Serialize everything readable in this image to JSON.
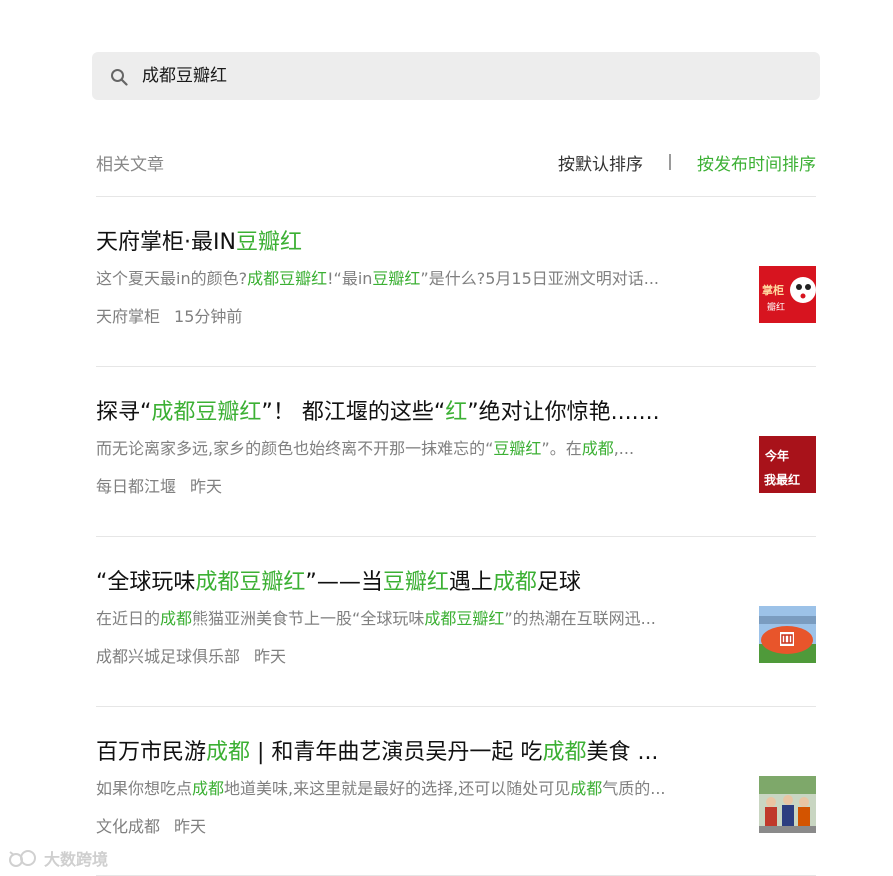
{
  "search": {
    "query": "成都豆瓣红",
    "icon": "search-icon"
  },
  "header": {
    "title": "相关文章",
    "sort_default": "按默认排序",
    "sort_time": "按发布时间排序"
  },
  "colors": {
    "highlight": "#3cb034",
    "muted": "#808080",
    "search_bg": "#ededed"
  },
  "articles": [
    {
      "title": [
        {
          "t": "天府掌柜·最IN",
          "h": false
        },
        {
          "t": "豆瓣红",
          "h": true
        }
      ],
      "snippet": [
        {
          "t": "这个夏天最in的颜色?",
          "h": false
        },
        {
          "t": "成都豆瓣红",
          "h": true
        },
        {
          "t": "!“最in",
          "h": false
        },
        {
          "t": "豆瓣红",
          "h": true
        },
        {
          "t": "”是什么?5月15日亚洲文明对话...",
          "h": false
        }
      ],
      "source": "天府掌柜",
      "time": "15分钟前",
      "thumb_text": [
        "掌柜",
        "瓣红"
      ]
    },
    {
      "title": [
        {
          "t": "探寻“",
          "h": false
        },
        {
          "t": "成都豆瓣红",
          "h": true
        },
        {
          "t": "”！ 都江堰的这些“",
          "h": false
        },
        {
          "t": "红",
          "h": true
        },
        {
          "t": "”绝对让你惊艳.......",
          "h": false
        }
      ],
      "snippet": [
        {
          "t": "而无论离家多远,家乡的颜色也始终离不开那一抹难忘的“",
          "h": false
        },
        {
          "t": "豆瓣红",
          "h": true
        },
        {
          "t": "”。在",
          "h": false
        },
        {
          "t": "成都",
          "h": true
        },
        {
          "t": ",...",
          "h": false
        }
      ],
      "source": "每日都江堰",
      "time": "昨天",
      "thumb_text": [
        "今年",
        "我最红"
      ]
    },
    {
      "title": [
        {
          "t": "“全球玩味",
          "h": false
        },
        {
          "t": "成都豆瓣红",
          "h": true
        },
        {
          "t": "”——当",
          "h": false
        },
        {
          "t": "豆瓣红",
          "h": true
        },
        {
          "t": "遇上",
          "h": false
        },
        {
          "t": "成都",
          "h": true
        },
        {
          "t": "足球",
          "h": false
        }
      ],
      "snippet": [
        {
          "t": "在近日的",
          "h": false
        },
        {
          "t": "成都",
          "h": true
        },
        {
          "t": "熊猫亚洲美食节上一股“全球玩味",
          "h": false
        },
        {
          "t": "成都豆瓣红",
          "h": true
        },
        {
          "t": "”的热潮在互联网迅...",
          "h": false
        }
      ],
      "source": "成都兴城足球俱乐部",
      "time": "昨天",
      "thumb_text": []
    },
    {
      "title": [
        {
          "t": "百万市民游",
          "h": false
        },
        {
          "t": "成都",
          "h": true
        },
        {
          "t": " | 和青年曲艺演员吴丹一起 吃",
          "h": false
        },
        {
          "t": "成都",
          "h": true
        },
        {
          "t": "美食 ...",
          "h": false
        }
      ],
      "snippet": [
        {
          "t": "如果你想吃点",
          "h": false
        },
        {
          "t": "成都",
          "h": true
        },
        {
          "t": "地道美味,来这里就是最好的选择,还可以随处可见",
          "h": false
        },
        {
          "t": "成都",
          "h": true
        },
        {
          "t": "气质的...",
          "h": false
        }
      ],
      "source": "文化成都",
      "time": "昨天",
      "thumb_text": []
    }
  ],
  "watermark": {
    "text": "大数跨境",
    "icon": "brand-logo-icon"
  }
}
